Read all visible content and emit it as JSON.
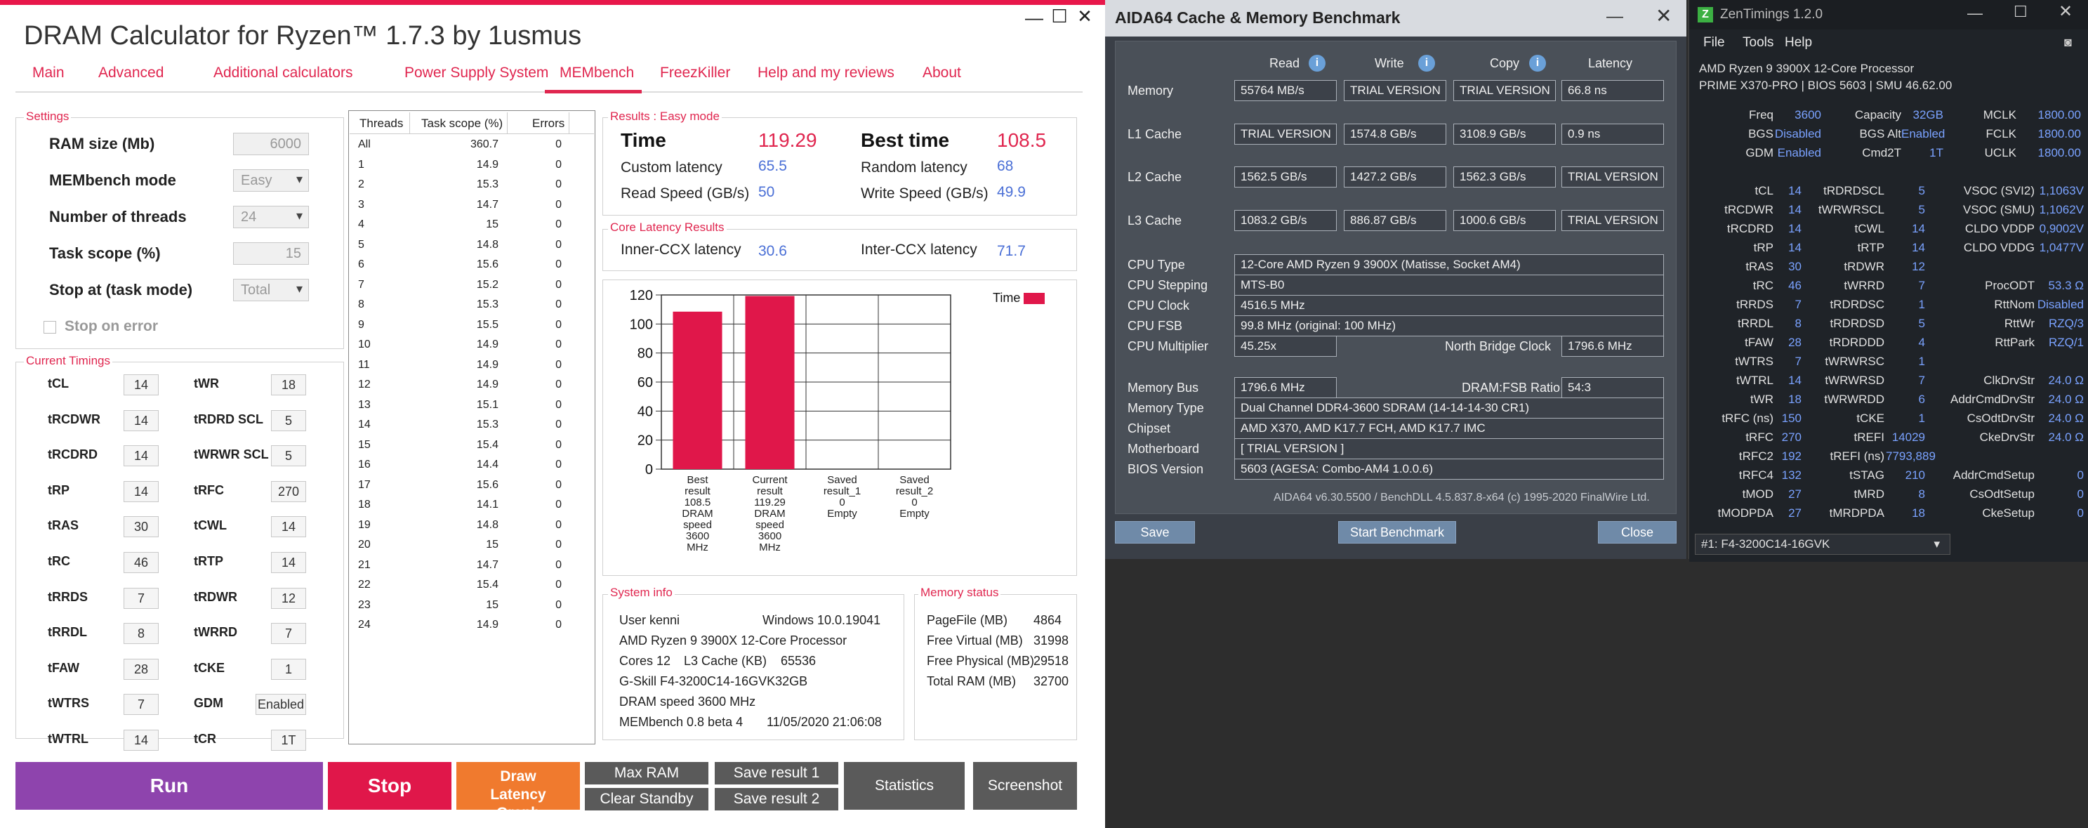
{
  "dram": {
    "title": "DRAM Calculator for Ryzen™ 1.7.3 by 1usmus",
    "window_controls": [
      "—",
      "☐",
      "✕"
    ],
    "tabs": [
      "Main",
      "Advanced",
      "Additional calculators",
      "Power Supply System",
      "MEMbench",
      "FreezKiller",
      "Help and my reviews",
      "About"
    ],
    "settings": {
      "group_label": "Settings",
      "ram_size_label": "RAM size (Mb)",
      "ram_size_value": "6000",
      "mode_label": "MEMbench mode",
      "mode_value": "Easy",
      "threads_label": "Number of threads",
      "threads_value": "24",
      "scope_label": "Task scope (%)",
      "scope_value": "15",
      "stop_label": "Stop at (task mode)",
      "stop_value": "Total",
      "stop_on_error": "Stop on error"
    },
    "timings": {
      "group_label": "Current Timings",
      "left": [
        [
          "tCL",
          "14"
        ],
        [
          "tRCDWR",
          "14"
        ],
        [
          "tRCDRD",
          "14"
        ],
        [
          "tRP",
          "14"
        ],
        [
          "tRAS",
          "30"
        ],
        [
          "tRC",
          "46"
        ],
        [
          "tRRDS",
          "7"
        ],
        [
          "tRRDL",
          "8"
        ],
        [
          "tFAW",
          "28"
        ],
        [
          "tWTRS",
          "7"
        ],
        [
          "tWTRL",
          "14"
        ]
      ],
      "right": [
        [
          "tWR",
          "18"
        ],
        [
          "tRDRD SCL",
          "5"
        ],
        [
          "tWRWR SCL",
          "5"
        ],
        [
          "tRFC",
          "270"
        ],
        [
          "tCWL",
          "14"
        ],
        [
          "tRTP",
          "14"
        ],
        [
          "tRDWR",
          "12"
        ],
        [
          "tWRRD",
          "7"
        ],
        [
          "tCKE",
          "1"
        ],
        [
          "GDM",
          "Enabled"
        ],
        [
          "tCR",
          "1T"
        ]
      ]
    },
    "threads_table": {
      "headers": [
        "Threads",
        "Task scope (%)",
        "Errors"
      ],
      "rows": [
        [
          "All",
          "360.7",
          "0"
        ],
        [
          "1",
          "14.9",
          "0"
        ],
        [
          "2",
          "15.3",
          "0"
        ],
        [
          "3",
          "14.7",
          "0"
        ],
        [
          "4",
          "15",
          "0"
        ],
        [
          "5",
          "14.8",
          "0"
        ],
        [
          "6",
          "15.6",
          "0"
        ],
        [
          "7",
          "15.2",
          "0"
        ],
        [
          "8",
          "15.3",
          "0"
        ],
        [
          "9",
          "15.5",
          "0"
        ],
        [
          "10",
          "14.9",
          "0"
        ],
        [
          "11",
          "14.9",
          "0"
        ],
        [
          "12",
          "14.9",
          "0"
        ],
        [
          "13",
          "15.1",
          "0"
        ],
        [
          "14",
          "15.3",
          "0"
        ],
        [
          "15",
          "15.4",
          "0"
        ],
        [
          "16",
          "14.4",
          "0"
        ],
        [
          "17",
          "15.6",
          "0"
        ],
        [
          "18",
          "14.1",
          "0"
        ],
        [
          "19",
          "14.8",
          "0"
        ],
        [
          "20",
          "15",
          "0"
        ],
        [
          "21",
          "14.7",
          "0"
        ],
        [
          "22",
          "15.4",
          "0"
        ],
        [
          "23",
          "15",
          "0"
        ],
        [
          "24",
          "14.9",
          "0"
        ]
      ]
    },
    "results": {
      "group_label": "Results : Easy mode",
      "time_label": "Time",
      "time_value": "119.29",
      "best_label": "Best time",
      "best_value": "108.5",
      "custom_latency_label": "Custom latency",
      "custom_latency_value": "65.5",
      "random_latency_label": "Random latency",
      "random_latency_value": "68",
      "read_speed_label": "Read Speed (GB/s)",
      "read_speed_value": "50",
      "write_speed_label": "Write Speed (GB/s)",
      "write_speed_value": "49.9"
    },
    "core_latency": {
      "group_label": "Core Latency Results",
      "inner_label": "Inner-CCX latency",
      "inner_value": "30.6",
      "inter_label": "Inter-CCX latency",
      "inter_value": "71.7"
    },
    "system_info": {
      "group_label": "System info",
      "user": "User kenni",
      "os": "Windows 10.0.19041",
      "cpu": "AMD Ryzen 9 3900X 12-Core Processor",
      "cores": "Cores 12",
      "l3": "L3 Cache (KB)",
      "l3_value": "65536",
      "mem": "G-Skill F4-3200C14-16GVK32GB",
      "speed": "DRAM speed 3600 MHz",
      "ver": "MEMbench 0.8 beta 4",
      "date": "11/05/2020 21:06:08"
    },
    "memory_status": {
      "group_label": "Memory status",
      "rows": [
        [
          "PageFile (MB)",
          "4864"
        ],
        [
          "Free Virtual (MB)",
          "31998"
        ],
        [
          "Free Physical (MB)",
          "29518"
        ],
        [
          "Total RAM (MB)",
          "32700"
        ]
      ]
    },
    "buttons": {
      "run": "Run",
      "stop": "Stop",
      "draw": "Draw Latency Graph",
      "max_ram": "Max RAM",
      "clear_standby": "Clear Standby",
      "save1": "Save result 1",
      "save2": "Save result 2",
      "statistics": "Statistics",
      "screenshot": "Screenshot"
    },
    "colors": {
      "accent": "#e0264f",
      "run": "#8e44ad",
      "stop": "#e0174a",
      "draw": "#f07a2e",
      "gray": "#5a5a5a"
    }
  },
  "chart_data": {
    "type": "bar",
    "categories": [
      "Best result 108.5 DRAM speed 3600 MHz",
      "Current result 119.29 DRAM speed 3600 MHz",
      "Saved result_1 0 Empty",
      "Saved result_2 0 Empty"
    ],
    "category_lines": [
      [
        "Best",
        "result",
        "108.5",
        "DRAM",
        "speed",
        "3600",
        "MHz"
      ],
      [
        "Current",
        "result",
        "119.29",
        "DRAM",
        "speed",
        "3600",
        "MHz"
      ],
      [
        "Saved",
        "result_1",
        "0",
        "Empty"
      ],
      [
        "Saved",
        "result_2",
        "0",
        "Empty"
      ]
    ],
    "series": [
      {
        "name": "Time",
        "values": [
          108.5,
          119.29,
          0,
          0
        ],
        "color": "#e0174a"
      }
    ],
    "yticks": [
      0,
      20,
      40,
      60,
      80,
      100,
      120
    ],
    "ylim": [
      0,
      120
    ],
    "legend": "top-right",
    "grid": true
  },
  "aida": {
    "title": "AIDA64 Cache & Memory Benchmark",
    "headers": [
      "Read",
      "Write",
      "Copy",
      "Latency"
    ],
    "rows": [
      [
        "Memory",
        "55764 MB/s",
        "TRIAL VERSION",
        "TRIAL VERSION",
        "66.8 ns"
      ],
      [
        "L1 Cache",
        "TRIAL VERSION",
        "1574.8 GB/s",
        "3108.9 GB/s",
        "0.9 ns"
      ],
      [
        "L2 Cache",
        "1562.5 GB/s",
        "1427.2 GB/s",
        "1562.3 GB/s",
        "TRIAL VERSION"
      ],
      [
        "L3 Cache",
        "1083.2 GB/s",
        "886.87 GB/s",
        "1000.6 GB/s",
        "TRIAL VERSION"
      ]
    ],
    "cpu_type_label": "CPU Type",
    "cpu_type": "12-Core AMD Ryzen 9 3900X  (Matisse, Socket AM4)",
    "cpu_stepping_label": "CPU Stepping",
    "cpu_stepping": "MTS-B0",
    "cpu_clock_label": "CPU Clock",
    "cpu_clock": "4516.5 MHz",
    "cpu_fsb_label": "CPU FSB",
    "cpu_fsb": "99.8 MHz  (original: 100 MHz)",
    "cpu_mult_label": "CPU Multiplier",
    "cpu_mult": "45.25x",
    "nb_clock_label": "North Bridge Clock",
    "nb_clock": "1796.6 MHz",
    "mem_bus_label": "Memory Bus",
    "mem_bus": "1796.6 MHz",
    "ratio_label": "DRAM:FSB Ratio",
    "ratio": "54:3",
    "mem_type_label": "Memory Type",
    "mem_type": "Dual Channel DDR4-3600 SDRAM  (14-14-14-30 CR1)",
    "chipset_label": "Chipset",
    "chipset": "AMD X370, AMD K17.7 FCH, AMD K17.7 IMC",
    "mobo_label": "Motherboard",
    "mobo": "[ TRIAL VERSION ]",
    "bios_label": "BIOS Version",
    "bios": "5603  (AGESA: Combo-AM4 1.0.0.6)",
    "footer": "AIDA64 v6.30.5500 / BenchDLL 4.5.837.8-x64  (c) 1995-2020 FinalWire Ltd.",
    "btn_save": "Save",
    "btn_start": "Start Benchmark",
    "btn_close": "Close"
  },
  "zen": {
    "title": "ZenTimings 1.2.0",
    "menu": [
      "File",
      "Tools",
      "Help"
    ],
    "cpu": "AMD Ryzen 9 3900X 12-Core Processor",
    "board": "PRIME X370-PRO | BIOS 5603 | SMU 46.62.00",
    "top": [
      [
        "Freq",
        "3600",
        "Capacity",
        "32GB",
        "MCLK",
        "1800.00"
      ],
      [
        "BGS",
        "Disabled",
        "BGS Alt",
        "Enabled",
        "FCLK",
        "1800.00"
      ],
      [
        "GDM",
        "Enabled",
        "Cmd2T",
        "1T",
        "UCLK",
        "1800.00"
      ]
    ],
    "rows": [
      [
        "tCL",
        "14",
        "tRDRDSCL",
        "5",
        "VSOC (SVI2)",
        "1,1063V"
      ],
      [
        "tRCDWR",
        "14",
        "tWRWRSCL",
        "5",
        "VSOC (SMU)",
        "1,1062V"
      ],
      [
        "tRCDRD",
        "14",
        "tCWL",
        "14",
        "CLDO VDDP",
        "0,9002V"
      ],
      [
        "tRP",
        "14",
        "tRTP",
        "14",
        "CLDO VDDG",
        "1,0477V"
      ],
      [
        "tRAS",
        "30",
        "tRDWR",
        "12",
        "",
        ""
      ],
      [
        "tRC",
        "46",
        "tWRRD",
        "7",
        "ProcODT",
        "53.3 Ω"
      ],
      [
        "tRRDS",
        "7",
        "tRDRDSC",
        "1",
        "RttNom",
        "Disabled"
      ],
      [
        "tRRDL",
        "8",
        "tRDRDSD",
        "5",
        "RttWr",
        "RZQ/3"
      ],
      [
        "tFAW",
        "28",
        "tRDRDDD",
        "4",
        "RttPark",
        "RZQ/1"
      ],
      [
        "tWTRS",
        "7",
        "tWRWRSC",
        "1",
        "",
        ""
      ],
      [
        "tWTRL",
        "14",
        "tWRWRSD",
        "7",
        "ClkDrvStr",
        "24.0 Ω"
      ],
      [
        "tWR",
        "18",
        "tWRWRDD",
        "6",
        "AddrCmdDrvStr",
        "24.0 Ω"
      ],
      [
        "tRFC (ns)",
        "150",
        "tCKE",
        "1",
        "CsOdtDrvStr",
        "24.0 Ω"
      ],
      [
        "tRFC",
        "270",
        "tREFI",
        "14029",
        "CkeDrvStr",
        "24.0 Ω"
      ],
      [
        "tRFC2",
        "192",
        "tREFI (ns)",
        "7793,889",
        "",
        ""
      ],
      [
        "tRFC4",
        "132",
        "tSTAG",
        "210",
        "AddrCmdSetup",
        "0"
      ],
      [
        "tMOD",
        "27",
        "tMRD",
        "8",
        "CsOdtSetup",
        "0"
      ],
      [
        "tMODPDA",
        "27",
        "tMRDPDA",
        "18",
        "CkeSetup",
        "0"
      ]
    ],
    "dimm": "#1: F4-3200C14-16GVK"
  }
}
